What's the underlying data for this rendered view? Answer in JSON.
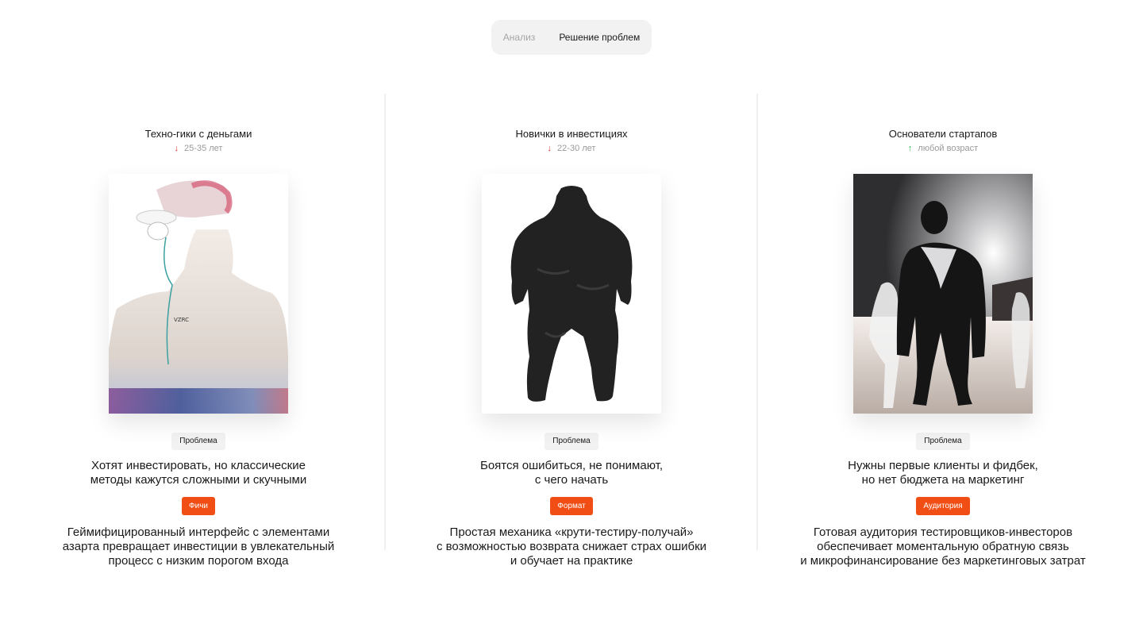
{
  "tabs": [
    {
      "label": "Анализ",
      "active": false
    },
    {
      "label": "Решение проблем",
      "active": true
    }
  ],
  "columns": [
    {
      "title": "Техно-гики с деньгами",
      "trend": "down",
      "age": "25-35 лет",
      "image_icon": "person-in-cap-photo",
      "problem_chip": "Проблема",
      "problem": "Хотят инвестировать, но классические\nметоды кажутся сложными и скучными",
      "solution_chip": "Фичи",
      "solution": "Геймифицированный интерфейс с элементами\nазарта превращает инвестиции в увлекательный\nпроцесс с низким порогом входа"
    },
    {
      "title": "Новички в инвестициях",
      "trend": "down",
      "age": "22-30 лет",
      "image_icon": "dark-silhouette-photo",
      "problem_chip": "Проблема",
      "problem": "Боятся ошибиться, не понимают,\nс чего начать",
      "solution_chip": "Формат",
      "solution": "Простая механика «крути-тестиру-получай»\nс возможностью возврата снижает страх ошибки\nи обучает на практике"
    },
    {
      "title": "Основатели стартапов",
      "trend": "up",
      "age": "любой возраст",
      "image_icon": "founders-group-photo",
      "problem_chip": "Проблема",
      "problem": "Нужны первые клиенты и фидбек,\nно нет бюджета на маркетинг",
      "solution_chip": "Аудитория",
      "solution": "Готовая аудитория тестировщиков-инвесторов\nобеспечивает моментальную обратную связь\nи микрофинансирование без маркетинговых затрат"
    }
  ],
  "colors": {
    "accent": "#f04e14",
    "trend_down": "#e23b2e",
    "trend_up": "#2bb04b",
    "chip_bg": "#f2f2f2"
  }
}
